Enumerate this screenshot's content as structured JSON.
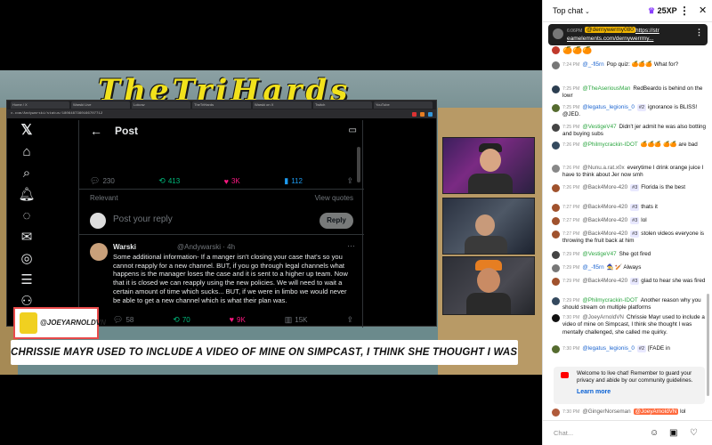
{
  "stream": {
    "banner_title": "TheTriHards",
    "browser_tabs": [
      "Home / X",
      "Warski Live",
      "Lolcow",
      "TheTriHards",
      "Warski on X",
      "Twitch",
      "YouTube"
    ],
    "url": "x.com/Andywarski/status/1806487360166707712",
    "post": {
      "title": "Post",
      "stats_top": {
        "replies": "230",
        "reposts": "413",
        "likes": "3K",
        "bookmarks": "112"
      },
      "relevant": "Relevant",
      "view_quotes": "View quotes",
      "reply_placeholder": "Post your reply",
      "reply_button": "Reply",
      "reply_name": "Warski",
      "reply_handle": "@Andywarski · 4h",
      "reply_body": "Some additional information- If a manger isn't closing your case that's so you cannot reapply for a new channel. BUT, if you go through legal channels what happens is the manager loses the case and it is sent to a higher up team. Now that it is closed we can reapply using the new policies. We will need to wait a certain amount of time which sucks... BUT, if we were in limbo we would never be able to get a new channel which is what their plan was.",
      "stats_bottom": {
        "replies": "58",
        "reposts": "70",
        "likes": "9K",
        "views": "15K"
      }
    },
    "badge_name": "@JOEYARNOLDVN",
    "caption": "CHRISSIE MAYR USED TO INCLUDE A VIDEO OF MINE ON SIMPCAST, I THINK SHE THOUGHT I WAS MENTALLY CHALLENGED, SHE CALLED ME QUIRKY."
  },
  "chat": {
    "mode": "Top chat",
    "xp": "25XP",
    "pinned": {
      "time": "6:06PM",
      "user": "@dernywermy080",
      "link1": "https://str",
      "link2": "eamelements.com/dernywerrmy..."
    },
    "messages": [
      {
        "time": "",
        "user": "",
        "text": "🍊🍊🍊",
        "avatar": "#c0392b"
      },
      {
        "time": "7:24 PM",
        "user": "@_-fl5rn",
        "text": "Pop quiz: 🍊🍊🍊 What for?",
        "avatar": "#777"
      },
      {
        "time": "7:25 PM",
        "user": "@TheAseriousMan",
        "text": "RedBeardo is behind on the lowr",
        "avatar": "#2c3e50"
      },
      {
        "time": "7:25 PM",
        "user": "@legatus_legionis_0",
        "text": "ignorance is BLISS! @JED.",
        "badge": "#2",
        "avatar": "#556b2f"
      },
      {
        "time": "7:25 PM",
        "user": "@VestigeV47",
        "text": "Didn't jer admit he was also botting and buying subs",
        "avatar": "#444"
      },
      {
        "time": "7:26 PM",
        "user": "@Philmycrackin-IDOT",
        "text": "🍊🍊🍊 🍊🍊 are bad",
        "avatar": "#34495e"
      },
      {
        "time": "7:26 PM",
        "user": "@Nunu.a.rat.x0x",
        "text": "everytime I drink orange juice I have to think about Jer now smh",
        "avatar": "#888"
      },
      {
        "time": "7:26 PM",
        "user": "@Back4More-420",
        "text": "Florida is the best",
        "badge": "#3",
        "avatar": "#a0522d"
      },
      {
        "time": "7:27 PM",
        "user": "@Back4More-420",
        "text": "thats it",
        "badge": "#3",
        "avatar": "#a0522d"
      },
      {
        "time": "7:27 PM",
        "user": "@Back4More-420",
        "text": "lol",
        "badge": "#3",
        "avatar": "#a0522d"
      },
      {
        "time": "7:27 PM",
        "user": "@Back4More-420",
        "text": "stolen videos everyone is throwing the fruit back at him",
        "badge": "#3",
        "avatar": "#a0522d"
      },
      {
        "time": "7:29 PM",
        "user": "@VestigeV47",
        "text": "She got fired",
        "avatar": "#444"
      },
      {
        "time": "7:29 PM",
        "user": "@_-fl5rn",
        "text": "🧙 🏏 Always",
        "avatar": "#777"
      },
      {
        "time": "7:29 PM",
        "user": "@Back4More-420",
        "text": "glad to hear she was fired",
        "badge": "#3",
        "avatar": "#a0522d"
      },
      {
        "time": "7:29 PM",
        "user": "@Philmycrackin-IDOT",
        "text": "Another reason why you should stream on multiple platforms",
        "avatar": "#34495e"
      },
      {
        "time": "7:30 PM",
        "user": "@JoeyArnoldVN",
        "text": "Chrissie Mayr used to include a video of mine on Simpcast, I think she thought I was mentally challenged, she called me quirky.",
        "avatar": "#111"
      },
      {
        "time": "7:30 PM",
        "user": "@legatus_legionis_0",
        "text": "[FADE in",
        "badge": "#2",
        "avatar": "#556b2f"
      },
      {
        "time": "7:30 PM",
        "user": "@GingerNorseman",
        "text": "lol",
        "mention": "@JoeyArnoldVN",
        "avatar": "#b05a3a"
      }
    ],
    "welcome": {
      "text": "Welcome to live chat! Remember to guard your privacy and abide by our community guidelines.",
      "link": "Learn more"
    },
    "input_placeholder": "Chat..."
  }
}
